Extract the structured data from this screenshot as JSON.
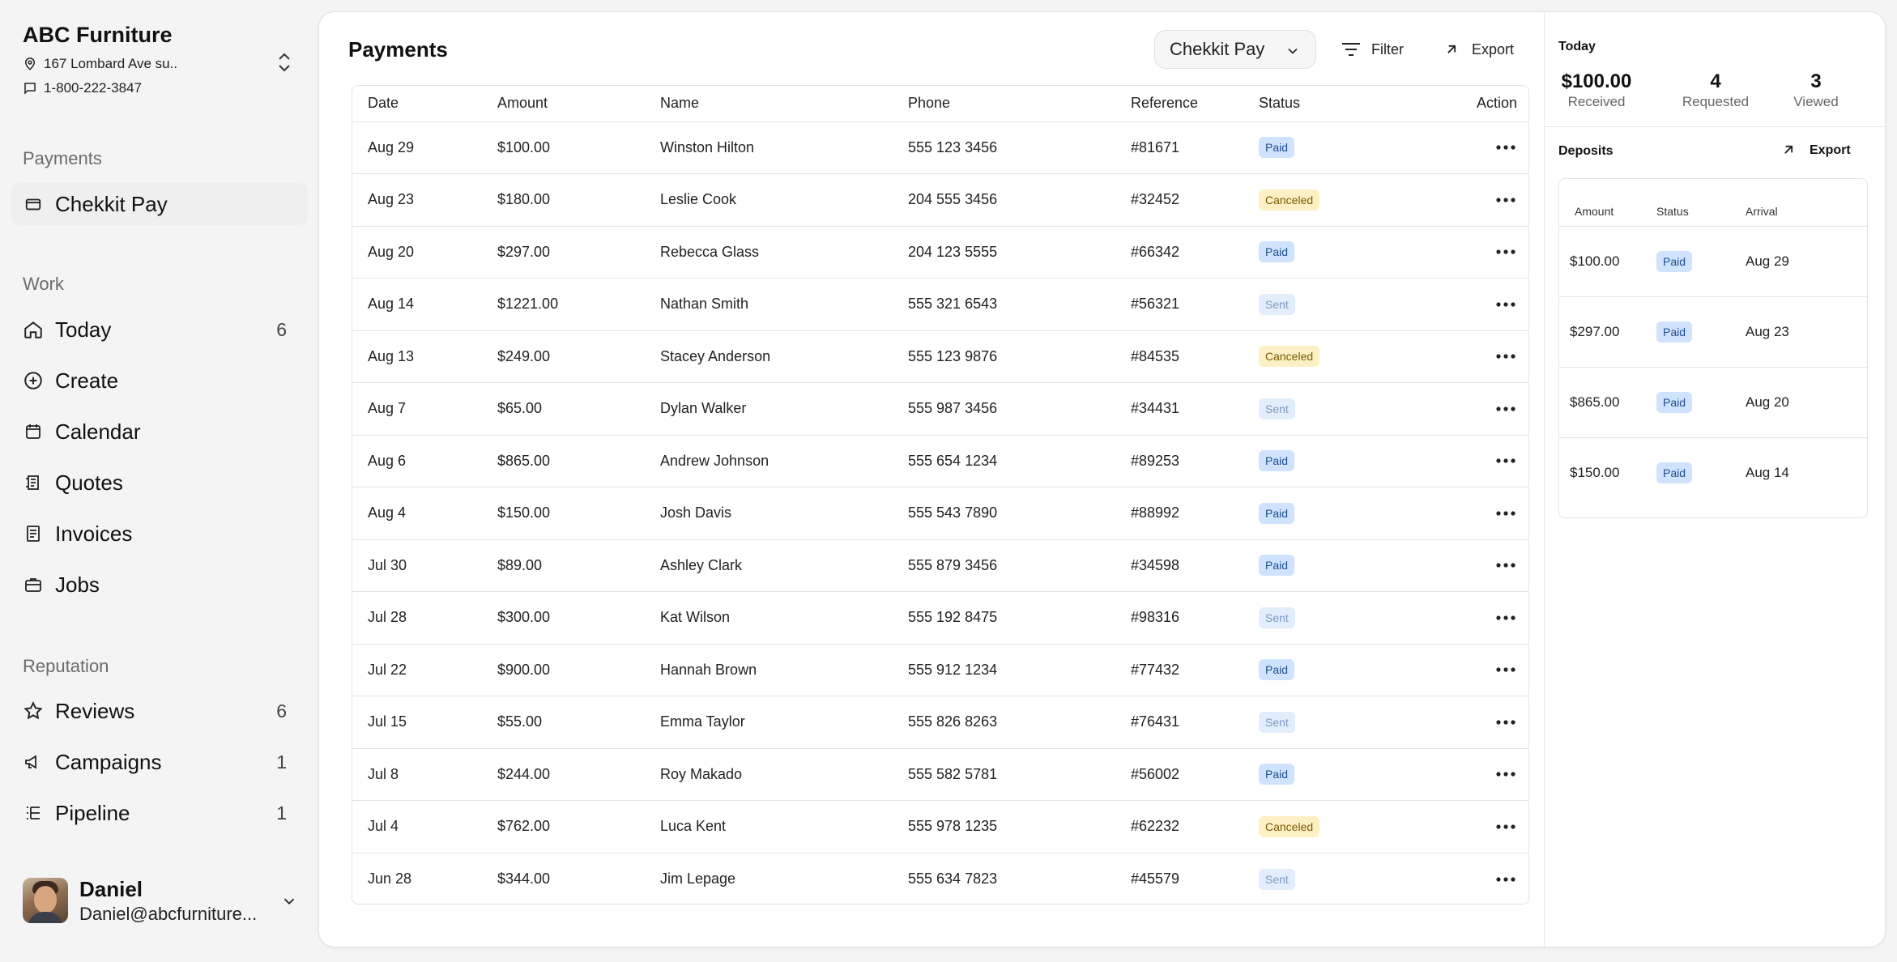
{
  "business": {
    "name": "ABC Furniture",
    "address": "167 Lombard Ave su..",
    "phone": "1-800-222-3847"
  },
  "sidebar": {
    "payments_section": "Payments",
    "payments_item": "Chekkit Pay",
    "work_section": "Work",
    "work_items": [
      {
        "label": "Today",
        "count": "6",
        "icon": "home-icon"
      },
      {
        "label": "Create",
        "count": "",
        "icon": "plus-circle-icon"
      },
      {
        "label": "Calendar",
        "count": "",
        "icon": "calendar-icon"
      },
      {
        "label": "Quotes",
        "count": "",
        "icon": "quotes-icon"
      },
      {
        "label": "Invoices",
        "count": "",
        "icon": "invoice-icon"
      },
      {
        "label": "Jobs",
        "count": "",
        "icon": "briefcase-icon"
      }
    ],
    "reputation_section": "Reputation",
    "reputation_items": [
      {
        "label": "Reviews",
        "count": "6",
        "icon": "star-icon"
      },
      {
        "label": "Campaigns",
        "count": "1",
        "icon": "megaphone-icon"
      },
      {
        "label": "Pipeline",
        "count": "1",
        "icon": "pipeline-icon"
      }
    ]
  },
  "user": {
    "name": "Daniel",
    "email": "Daniel@abcfurniture..."
  },
  "main": {
    "title": "Payments",
    "processor": "Chekkit Pay",
    "filter_label": "Filter",
    "export_label": "Export",
    "columns": [
      "Date",
      "Amount",
      "Name",
      "Phone",
      "Reference",
      "Status",
      "Action"
    ],
    "rows": [
      {
        "date": "Aug 29",
        "amount": "$100.00",
        "name": "Winston Hilton",
        "phone": "555 123 3456",
        "ref": "#81671",
        "status": "Paid"
      },
      {
        "date": "Aug 23",
        "amount": "$180.00",
        "name": "Leslie Cook",
        "phone": "204 555 3456",
        "ref": "#32452",
        "status": "Canceled"
      },
      {
        "date": "Aug 20",
        "amount": "$297.00",
        "name": "Rebecca Glass",
        "phone": "204 123 5555",
        "ref": "#66342",
        "status": "Paid"
      },
      {
        "date": "Aug 14",
        "amount": "$1221.00",
        "name": "Nathan Smith",
        "phone": "555 321 6543",
        "ref": "#56321",
        "status": "Sent"
      },
      {
        "date": "Aug 13",
        "amount": "$249.00",
        "name": "Stacey Anderson",
        "phone": "555 123 9876",
        "ref": "#84535",
        "status": "Canceled"
      },
      {
        "date": "Aug 7",
        "amount": "$65.00",
        "name": "Dylan Walker",
        "phone": "555 987 3456",
        "ref": "#34431",
        "status": "Sent"
      },
      {
        "date": "Aug 6",
        "amount": "$865.00",
        "name": "Andrew Johnson",
        "phone": "555 654 1234",
        "ref": "#89253",
        "status": "Paid"
      },
      {
        "date": "Aug 4",
        "amount": "$150.00",
        "name": "Josh Davis",
        "phone": "555 543 7890",
        "ref": "#88992",
        "status": "Paid"
      },
      {
        "date": "Jul 30",
        "amount": "$89.00",
        "name": "Ashley Clark",
        "phone": "555 879 3456",
        "ref": "#34598",
        "status": "Paid"
      },
      {
        "date": "Jul 28",
        "amount": "$300.00",
        "name": "Kat Wilson",
        "phone": "555 192 8475",
        "ref": "#98316",
        "status": "Sent"
      },
      {
        "date": "Jul 22",
        "amount": "$900.00",
        "name": "Hannah Brown",
        "phone": "555 912 1234",
        "ref": "#77432",
        "status": "Paid"
      },
      {
        "date": "Jul 15",
        "amount": "$55.00",
        "name": "Emma Taylor",
        "phone": "555 826 8263",
        "ref": "#76431",
        "status": "Sent"
      },
      {
        "date": "Jul 8",
        "amount": "$244.00",
        "name": "Roy Makado",
        "phone": "555 582 5781",
        "ref": "#56002",
        "status": "Paid"
      },
      {
        "date": "Jul 4",
        "amount": "$762.00",
        "name": "Luca Kent",
        "phone": "555 978 1235",
        "ref": "#62232",
        "status": "Canceled"
      },
      {
        "date": "Jun 28",
        "amount": "$344.00",
        "name": "Jim Lepage",
        "phone": "555 634 7823",
        "ref": "#45579",
        "status": "Sent"
      }
    ]
  },
  "right": {
    "today_label": "Today",
    "received_value": "$100.00",
    "received_label": "Received",
    "requested_value": "4",
    "requested_label": "Requested",
    "viewed_value": "3",
    "viewed_label": "Viewed",
    "deposits_label": "Deposits",
    "export_label": "Export",
    "deposit_columns": [
      "Amount",
      "Status",
      "Arrival"
    ],
    "deposits": [
      {
        "amount": "$100.00",
        "status": "Paid",
        "arrival": "Aug 29"
      },
      {
        "amount": "$297.00",
        "status": "Paid",
        "arrival": "Aug 23"
      },
      {
        "amount": "$865.00",
        "status": "Paid",
        "arrival": "Aug 20"
      },
      {
        "amount": "$150.00",
        "status": "Paid",
        "arrival": "Aug 14"
      }
    ]
  },
  "colors": {
    "paid_bg": "#cfe3ff",
    "canceled_bg": "#fdf0c4",
    "sent_bg": "#e3eefc"
  }
}
